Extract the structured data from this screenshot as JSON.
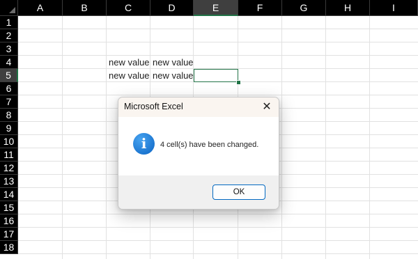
{
  "columns": [
    "A",
    "B",
    "C",
    "D",
    "E",
    "F",
    "G",
    "H",
    "I"
  ],
  "rows": [
    "1",
    "2",
    "3",
    "4",
    "5",
    "6",
    "7",
    "8",
    "9",
    "10",
    "11",
    "12",
    "13",
    "14",
    "15",
    "16",
    "17",
    "18"
  ],
  "selected_column": "E",
  "selected_row": "5",
  "cells": {
    "C4": "new value",
    "D4": "new value",
    "C5": "new value",
    "D5": "new value"
  },
  "dialog": {
    "title": "Microsoft Excel",
    "close_symbol": "✕",
    "icon": "info-icon",
    "icon_glyph": "i",
    "message": "4 cell(s) have been changed.",
    "ok_label": "OK"
  },
  "colors": {
    "accent": "#217346",
    "header_bg": "#000000",
    "info_blue": "#0b64c4"
  }
}
